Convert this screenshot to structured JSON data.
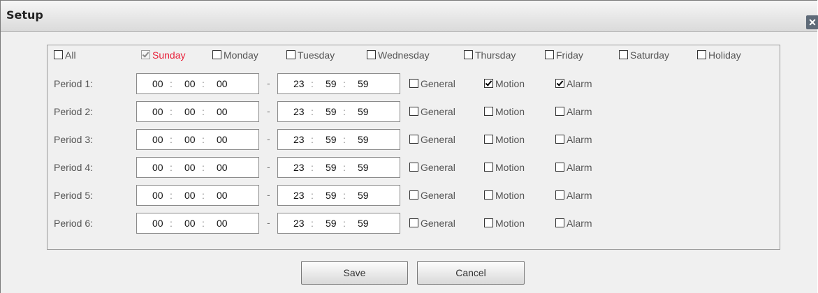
{
  "window": {
    "title": "Setup",
    "close_glyph": "✕"
  },
  "days": [
    {
      "label": "All",
      "checked": false,
      "selected": false,
      "disabled": false
    },
    {
      "label": "Sunday",
      "checked": true,
      "selected": true,
      "disabled": true
    },
    {
      "label": "Monday",
      "checked": false,
      "selected": false,
      "disabled": false
    },
    {
      "label": "Tuesday",
      "checked": false,
      "selected": false,
      "disabled": false
    },
    {
      "label": "Wednesday",
      "checked": false,
      "selected": false,
      "disabled": false
    },
    {
      "label": "Thursday",
      "checked": false,
      "selected": false,
      "disabled": false
    },
    {
      "label": "Friday",
      "checked": false,
      "selected": false,
      "disabled": false
    },
    {
      "label": "Saturday",
      "checked": false,
      "selected": false,
      "disabled": false
    },
    {
      "label": "Holiday",
      "checked": false,
      "selected": false,
      "disabled": false
    }
  ],
  "time_separator": ":",
  "range_separator": "-",
  "periods": [
    {
      "label": "Period 1:",
      "start": [
        "00",
        "00",
        "00"
      ],
      "end": [
        "23",
        "59",
        "59"
      ],
      "general": false,
      "motion": true,
      "alarm": true
    },
    {
      "label": "Period 2:",
      "start": [
        "00",
        "00",
        "00"
      ],
      "end": [
        "23",
        "59",
        "59"
      ],
      "general": false,
      "motion": false,
      "alarm": false
    },
    {
      "label": "Period 3:",
      "start": [
        "00",
        "00",
        "00"
      ],
      "end": [
        "23",
        "59",
        "59"
      ],
      "general": false,
      "motion": false,
      "alarm": false
    },
    {
      "label": "Period 4:",
      "start": [
        "00",
        "00",
        "00"
      ],
      "end": [
        "23",
        "59",
        "59"
      ],
      "general": false,
      "motion": false,
      "alarm": false
    },
    {
      "label": "Period 5:",
      "start": [
        "00",
        "00",
        "00"
      ],
      "end": [
        "23",
        "59",
        "59"
      ],
      "general": false,
      "motion": false,
      "alarm": false
    },
    {
      "label": "Period 6:",
      "start": [
        "00",
        "00",
        "00"
      ],
      "end": [
        "23",
        "59",
        "59"
      ],
      "general": false,
      "motion": false,
      "alarm": false
    }
  ],
  "type_labels": {
    "general": "General",
    "motion": "Motion",
    "alarm": "Alarm"
  },
  "buttons": {
    "save": "Save",
    "cancel": "Cancel"
  },
  "colors": {
    "selected_day": "#e8213a"
  }
}
